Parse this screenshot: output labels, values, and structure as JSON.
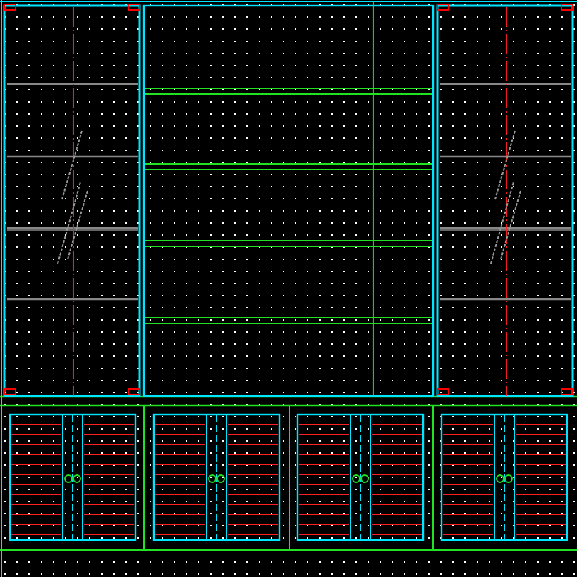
{
  "canvas": {
    "upper_bays": [
      {
        "kind": "glass"
      },
      {
        "kind": "open"
      },
      {
        "kind": "glass"
      }
    ],
    "lower_cabinets": [
      {
        "kind": "double-door"
      },
      {
        "kind": "double-door"
      },
      {
        "kind": "double-door"
      },
      {
        "kind": "double-door"
      }
    ]
  }
}
